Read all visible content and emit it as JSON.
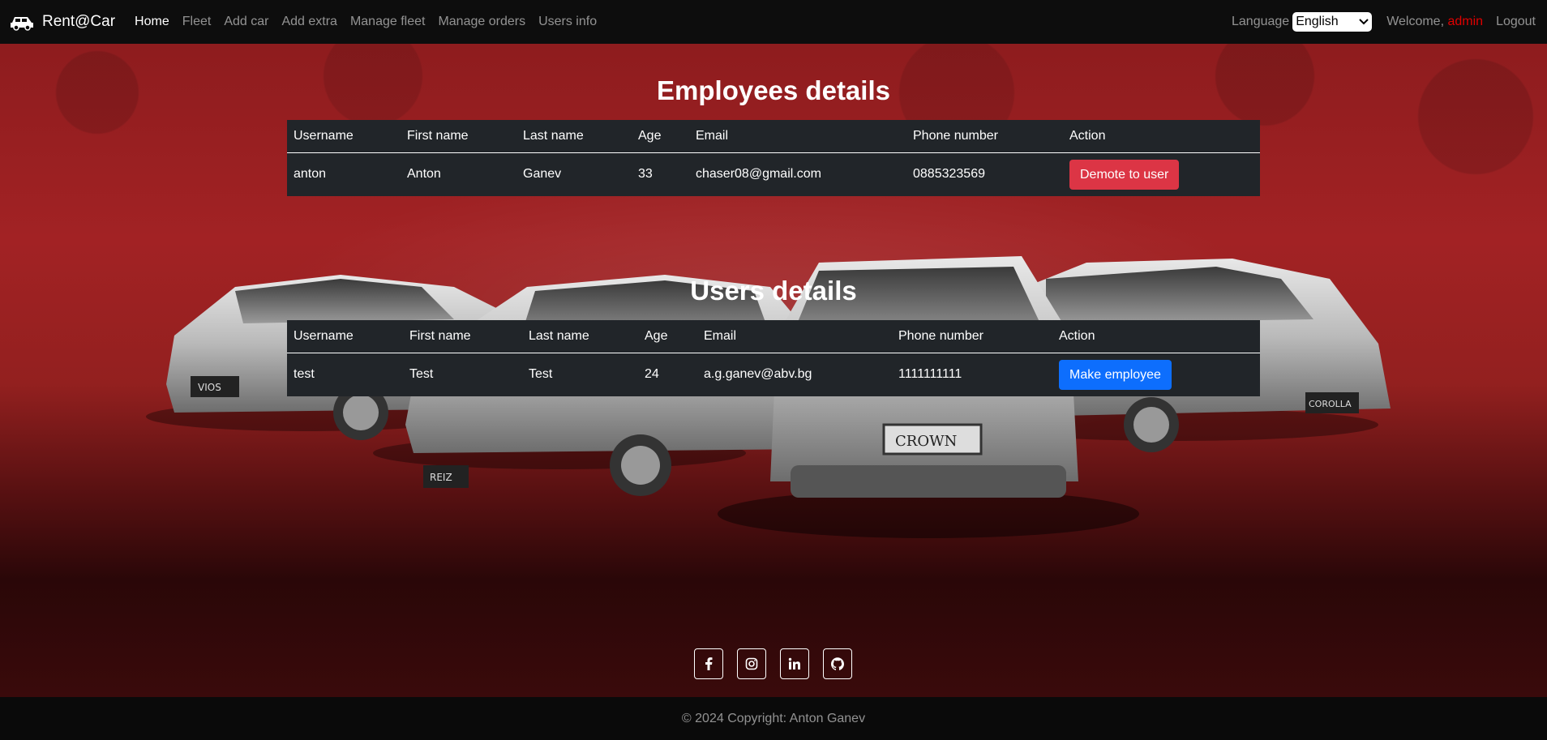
{
  "navbar": {
    "brand": "Rent@Car",
    "links": [
      "Home",
      "Fleet",
      "Add car",
      "Add extra",
      "Manage fleet",
      "Manage orders",
      "Users info"
    ],
    "language_label": "Language",
    "language_selected": "English",
    "welcome": "Welcome,",
    "username": "admin",
    "logout": "Logout"
  },
  "employees": {
    "title": "Employees details",
    "columns": [
      "Username",
      "First name",
      "Last name",
      "Age",
      "Email",
      "Phone number",
      "Action"
    ],
    "rows": [
      {
        "username": "anton",
        "first_name": "Anton",
        "last_name": "Ganev",
        "age": "33",
        "email": "chaser08@gmail.com",
        "phone": "0885323569",
        "action": "Demote to user"
      }
    ]
  },
  "users": {
    "title": "Users details",
    "columns": [
      "Username",
      "First name",
      "Last name",
      "Age",
      "Email",
      "Phone number",
      "Action"
    ],
    "rows": [
      {
        "username": "test",
        "first_name": "Test",
        "last_name": "Test",
        "age": "24",
        "email": "a.g.ganev@abv.bg",
        "phone": "1111111111",
        "action": "Make employee"
      }
    ]
  },
  "background_car_plates": [
    "VIOS",
    "REIZ",
    "CROWN",
    "COROLLA"
  ],
  "social_icons": [
    "facebook-icon",
    "instagram-icon",
    "linkedin-icon",
    "github-icon"
  ],
  "footer": {
    "copyright": "© 2024 Copyright: Anton Ganev"
  },
  "colors": {
    "danger": "#dc3545",
    "primary": "#0d6efd",
    "table_bg": "#212529",
    "username_highlight": "#e00000"
  }
}
